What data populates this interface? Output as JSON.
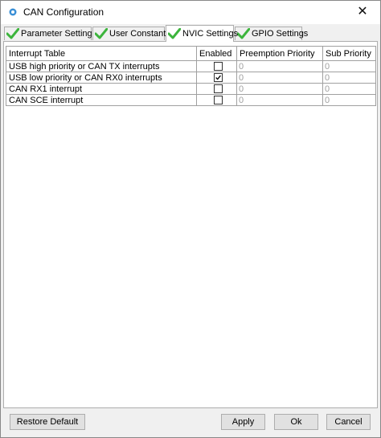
{
  "window": {
    "title": "CAN Configuration",
    "close_glyph": "✕"
  },
  "tabs": [
    {
      "label": "Parameter Settings",
      "icon": "green-check-icon"
    },
    {
      "label": "User Constants",
      "icon": "green-check-icon"
    },
    {
      "label": "NVIC Settings",
      "icon": "green-check-icon",
      "active": true
    },
    {
      "label": "GPIO Settings",
      "icon": "green-check-icon"
    }
  ],
  "table": {
    "headers": [
      "Interrupt Table",
      "Enabled",
      "Preemption Priority",
      "Sub Priority"
    ],
    "rows": [
      {
        "name": "USB high priority or CAN TX interrupts",
        "enabled": false,
        "preemption": "0",
        "sub": "0"
      },
      {
        "name": "USB low priority or CAN RX0 interrupts",
        "enabled": true,
        "preemption": "0",
        "sub": "0"
      },
      {
        "name": "CAN RX1 interrupt",
        "enabled": false,
        "preemption": "0",
        "sub": "0"
      },
      {
        "name": "CAN SCE interrupt",
        "enabled": false,
        "preemption": "0",
        "sub": "0"
      }
    ]
  },
  "buttons": {
    "restore_default": "Restore Default",
    "apply": "Apply",
    "ok": "Ok",
    "cancel": "Cancel"
  },
  "colors": {
    "check_green": "#3cb43c",
    "window_bg": "#f0f0f0",
    "app_icon": "#3a8fd6"
  }
}
